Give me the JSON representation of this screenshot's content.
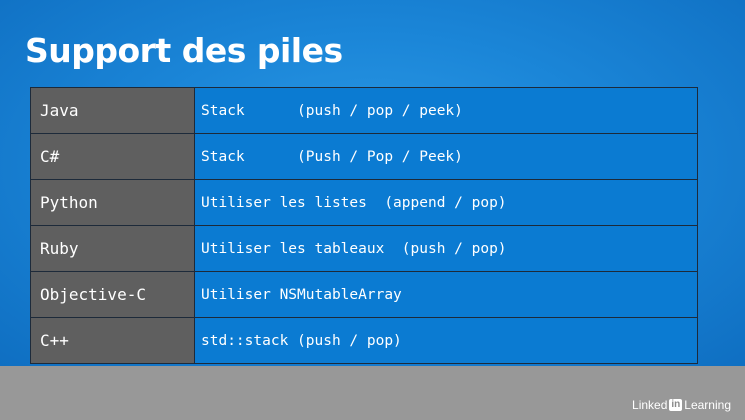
{
  "slide": {
    "title": "Support des piles",
    "rows": [
      {
        "language": "Java",
        "description": "Stack      (push / pop / peek)"
      },
      {
        "language": "C#",
        "description": "Stack      (Push / Pop / Peek)"
      },
      {
        "language": "Python",
        "description": "Utiliser les listes  (append / pop)"
      },
      {
        "language": "Ruby",
        "description": "Utiliser les tableaux  (push / pop)"
      },
      {
        "language": "Objective-C",
        "description": "Utiliser NSMutableArray"
      },
      {
        "language": "C++",
        "description": "std::stack (push / pop)"
      }
    ]
  },
  "watermark": {
    "linked": "Linked",
    "in": "in",
    "learning": "Learning"
  },
  "colors": {
    "background_blue": "#1b86d8",
    "language_cell": "#5f5f5f",
    "description_cell": "#0b7bd2",
    "floor": "#989898"
  }
}
